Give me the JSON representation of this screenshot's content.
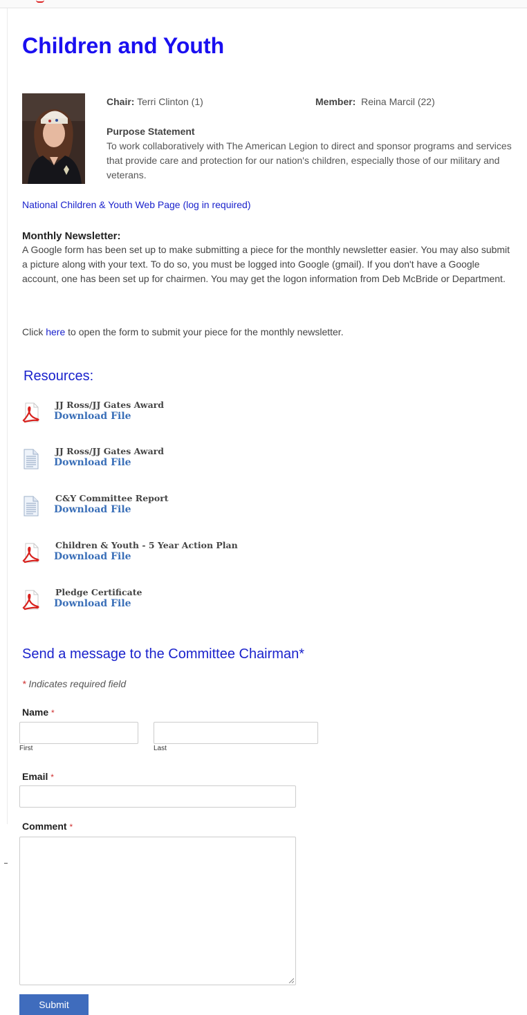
{
  "page": {
    "title": "Children and Youth"
  },
  "committee": {
    "chair_label": "Chair:",
    "chair_name": "Terri Clinton (1)",
    "member_label": "Member:",
    "member_name": "Reina Marcil (22)",
    "purpose_heading": "Purpose Statement",
    "purpose_text": "To work collaboratively with The American Legion to direct and sponsor programs and services that provide care and protection for our nation's children, especially those of our military and veterans.",
    "portrait_icon": "person-portrait-photo"
  },
  "links": {
    "national_page": "National Children & Youth Web Page (log in required)"
  },
  "newsletter": {
    "heading": "Monthly Newsletter:",
    "body": "A Google form has been set up to make submitting a piece for the monthly newsletter easier.  You may also submit a picture along with your text.  To do so, you must be logged into Google (gmail).  If you don't have a Google account, one has been set up for chairmen.  You may get the logon information from Deb McBride or Department.",
    "click_prefix": "Click ",
    "click_link": "here",
    "click_suffix": " to open the form to submit your piece for the monthly newsletter."
  },
  "resources": {
    "heading": "Resources:",
    "items": [
      {
        "title": "JJ Ross/JJ Gates Award",
        "link": "Download File",
        "icon": "pdf-icon"
      },
      {
        "title": "JJ Ross/JJ Gates Award",
        "link": "Download File",
        "icon": "document-icon"
      },
      {
        "title": "C&Y Committee Report",
        "link": "Download File",
        "icon": "document-icon"
      },
      {
        "title": "Children & Youth - 5 Year Action Plan",
        "link": "Download File",
        "icon": "pdf-icon"
      },
      {
        "title": "Pledge Certificate",
        "link": "Download File",
        "icon": "pdf-icon"
      }
    ]
  },
  "form": {
    "heading": "Send a message to the Committee Chairman*",
    "required_star": "*",
    "required_note": " Indicates required field",
    "name_label": "Name",
    "first_sub": "First",
    "last_sub": "Last",
    "first_value": "",
    "last_value": "",
    "email_label": "Email",
    "email_value": "",
    "comment_label": "Comment",
    "comment_value": "",
    "submit_label": "Submit"
  },
  "colors": {
    "title_blue": "#1a0ff0",
    "link_blue": "#1a22cc",
    "download_blue": "#3a6fb8",
    "required_red": "#d03030",
    "submit_bg": "#3f6cbd"
  }
}
